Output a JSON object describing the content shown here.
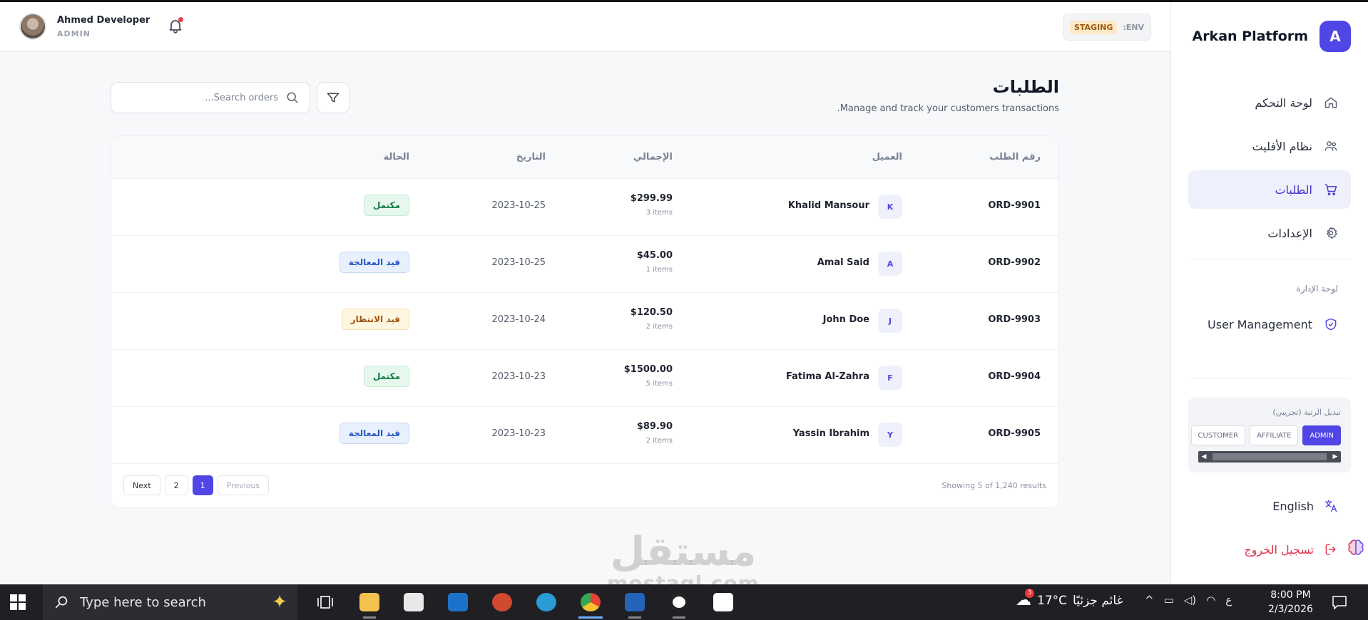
{
  "app": {
    "brand_initial": "A",
    "brand_name": "Arkan Platform"
  },
  "user": {
    "name": "Ahmed Developer",
    "role": "ADMIN"
  },
  "env": {
    "label": ":ENV",
    "value": "STAGING"
  },
  "sidebar": {
    "items": [
      {
        "label": "لوحة التحكم",
        "icon": "home-icon"
      },
      {
        "label": "نظام الأفليت",
        "icon": "users-icon"
      },
      {
        "label": "الطلبات",
        "icon": "cart-icon",
        "active": true
      },
      {
        "label": "الإعدادات",
        "icon": "gear-icon"
      }
    ],
    "section_label": "لوحة الإدارة",
    "admin_items": [
      {
        "label": "User Management",
        "icon": "shield-icon"
      }
    ],
    "role_switch": {
      "title": "تبديل الرتبة (تجريبي)",
      "options": [
        "ADMIN",
        "AFFILIATE",
        "CUSTOMER"
      ],
      "selected": "ADMIN"
    },
    "language": "English",
    "logout": "تسجيل الخروج"
  },
  "page": {
    "title": "الطلبات",
    "subtitle": "Manage and track your customers transactions.",
    "search_placeholder": "Search orders..."
  },
  "table": {
    "columns": {
      "order": "رقم الطلب",
      "customer": "العميل",
      "total": "الإجمالي",
      "date": "التاريخ",
      "status": "الحالة"
    },
    "rows": [
      {
        "id": "ORD-9901",
        "initial": "K",
        "customer": "Khalid Mansour",
        "total": "$299.99",
        "items": "3 items",
        "date": "2023-10-25",
        "status": "مكتمل",
        "status_kind": "done"
      },
      {
        "id": "ORD-9902",
        "initial": "A",
        "customer": "Amal Said",
        "total": "$45.00",
        "items": "1 items",
        "date": "2023-10-25",
        "status": "قيد المعالجة",
        "status_kind": "proc"
      },
      {
        "id": "ORD-9903",
        "initial": "J",
        "customer": "John Doe",
        "total": "$120.50",
        "items": "2 items",
        "date": "2023-10-24",
        "status": "قيد الانتظار",
        "status_kind": "wait"
      },
      {
        "id": "ORD-9904",
        "initial": "F",
        "customer": "Fatima Al-Zahra",
        "total": "$1500.00",
        "items": "5 items",
        "date": "2023-10-23",
        "status": "مكتمل",
        "status_kind": "done"
      },
      {
        "id": "ORD-9905",
        "initial": "Y",
        "customer": "Yassin Ibrahim",
        "total": "$89.90",
        "items": "2 items",
        "date": "2023-10-23",
        "status": "قيد المعالجة",
        "status_kind": "proc"
      }
    ],
    "results_text": "Showing 5 of 1,240 results",
    "pagination": {
      "next": "Next",
      "pages": [
        "2",
        "1"
      ],
      "current": "1",
      "previous": "Previous"
    }
  },
  "watermark": {
    "text": "مستقل",
    "url": "mostaql.com"
  },
  "taskbar": {
    "search_text": "Type here to search",
    "temperature": "17°C",
    "weather": "غائم جزئيًا",
    "weather_badge": "3",
    "lang_indicator": "ع",
    "time": "8:00 PM",
    "date": "2/3/2026"
  },
  "colors": {
    "accent": "#4f46e5",
    "active_nav_bg": "#eef0fb",
    "logout": "#e0314b",
    "staging_badge": "#fde9c8"
  }
}
